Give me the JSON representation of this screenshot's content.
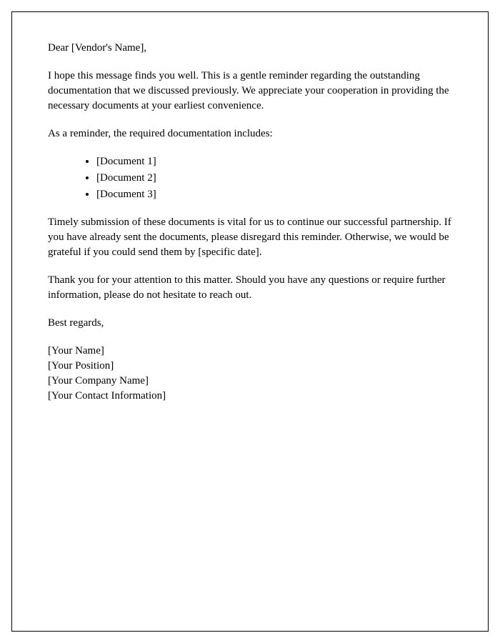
{
  "salutation": "Dear [Vendor's Name],",
  "paragraph1": "I hope this message finds you well. This is a gentle reminder regarding the outstanding documentation that we discussed previously. We appreciate your cooperation in providing the necessary documents at your earliest convenience.",
  "paragraph2": "As a reminder, the required documentation includes:",
  "documents": [
    "[Document 1]",
    "[Document 2]",
    "[Document 3]"
  ],
  "paragraph3": "Timely submission of these documents is vital for us to continue our successful partnership. If you have already sent the documents, please disregard this reminder. Otherwise, we would be grateful if you could send them by [specific date].",
  "paragraph4": "Thank you for your attention to this matter. Should you have any questions or require further information, please do not hesitate to reach out.",
  "closing": "Best regards,",
  "signature": {
    "name": "[Your Name]",
    "position": "[Your Position]",
    "company": "[Your Company Name]",
    "contact": "[Your Contact Information]"
  }
}
